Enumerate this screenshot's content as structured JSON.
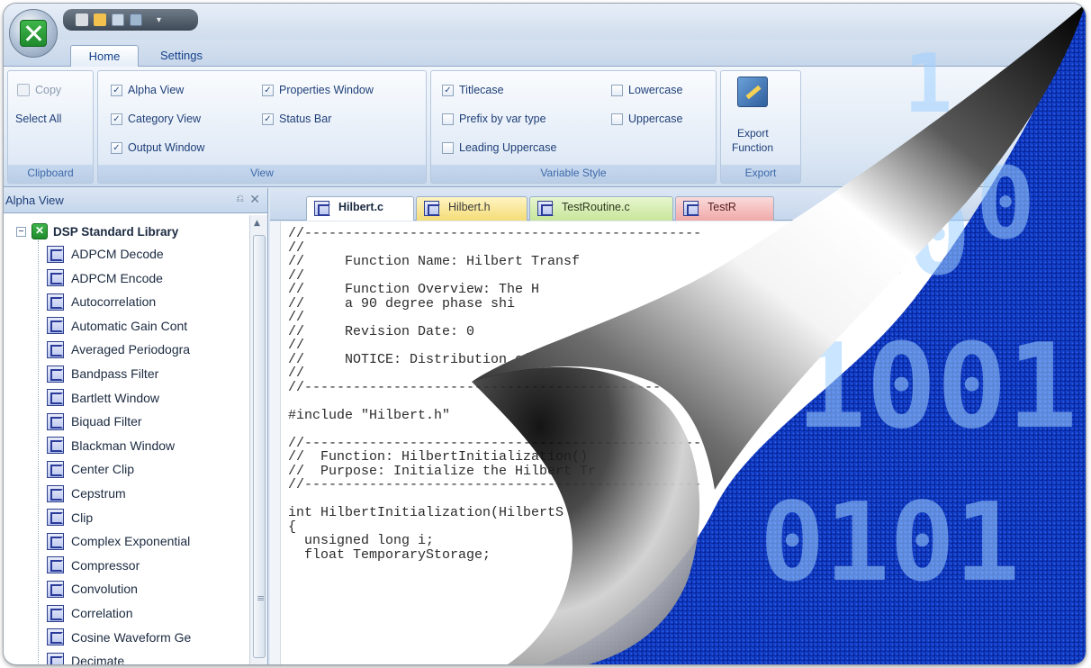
{
  "ribbon": {
    "tabs": [
      {
        "label": "Home"
      },
      {
        "label": "Settings"
      }
    ],
    "clipboard": {
      "copy": "Copy",
      "select_all": "Select All",
      "group_label": "Clipboard"
    },
    "view": {
      "alpha_view": "Alpha View",
      "category_view": "Category View",
      "output_window": "Output Window",
      "properties_window": "Properties Window",
      "status_bar": "Status Bar",
      "group_label": "View"
    },
    "variable_style": {
      "titlecase": "Titlecase",
      "prefix_by_var_type": "Prefix by var type",
      "leading_uppercase": "Leading Uppercase",
      "lowercase": "Lowercase",
      "uppercase": "Uppercase",
      "group_label": "Variable Style"
    },
    "export": {
      "button_line1": "Export",
      "button_line2": "Function",
      "group_label": "Export"
    }
  },
  "left_pane": {
    "title": "Alpha View",
    "pin_glyph": "p",
    "close_glyph": "✕",
    "root_label": "DSP Standard Library",
    "items": [
      {
        "label": "ADPCM Decode"
      },
      {
        "label": "ADPCM Encode"
      },
      {
        "label": "Autocorrelation"
      },
      {
        "label": "Automatic Gain Cont"
      },
      {
        "label": "Averaged Periodogra"
      },
      {
        "label": "Bandpass Filter"
      },
      {
        "label": "Bartlett Window"
      },
      {
        "label": "Biquad Filter"
      },
      {
        "label": "Blackman Window"
      },
      {
        "label": "Center Clip"
      },
      {
        "label": "Cepstrum"
      },
      {
        "label": "Clip"
      },
      {
        "label": "Complex Exponential"
      },
      {
        "label": "Compressor"
      },
      {
        "label": "Convolution"
      },
      {
        "label": "Correlation"
      },
      {
        "label": "Cosine Waveform Ge"
      },
      {
        "label": "Decimate"
      }
    ]
  },
  "doc_tabs": [
    {
      "label": "Hilbert.c"
    },
    {
      "label": "Hilbert.h"
    },
    {
      "label": "TestRoutine.c"
    },
    {
      "label": "TestR"
    }
  ],
  "code_lines": [
    "//-------------------------------------------------",
    "//",
    "//     Function Name: Hilbert Transf",
    "//",
    "//     Function Overview: The H",
    "//     a 90 degree phase shi",
    "//",
    "//     Revision Date: 0",
    "//",
    "//     NOTICE: Distribution of th",
    "//",
    "//-------------------------------------------------",
    "",
    "#include \"Hilbert.h\"",
    "",
    "//-------------------------------------------------",
    "//  Function: HilbertInitialization()",
    "//  Purpose: Initialize the Hilbert Tr",
    "//-------------------------------------------------",
    "",
    "int HilbertInitialization(HilbertS",
    "{",
    "  unsigned long i;",
    "  float TemporaryStorage;"
  ],
  "colors": {
    "ribbon_text": "#1f3f78",
    "accent_blue": "#15428b",
    "binary_background": "#0a2fb8"
  }
}
